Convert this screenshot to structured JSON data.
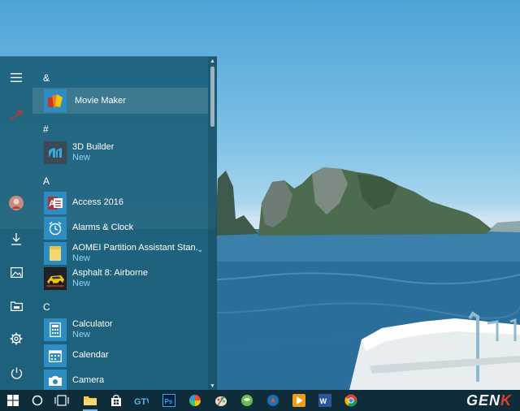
{
  "start_menu": {
    "left_rail": [
      {
        "name": "hamburger-menu-icon",
        "glyph": "≡"
      },
      {
        "name": "user-avatar-icon",
        "glyph": ""
      },
      {
        "name": "downloads-icon",
        "glyph": "⤓"
      },
      {
        "name": "pictures-icon",
        "glyph": ""
      },
      {
        "name": "file-explorer-icon",
        "glyph": ""
      },
      {
        "name": "settings-icon",
        "glyph": "⚙"
      },
      {
        "name": "power-icon",
        "glyph": "⏻"
      }
    ],
    "sections": {
      "ampersand": "&",
      "hash": "#",
      "a": "A",
      "c": "C"
    },
    "apps": {
      "movie_maker": {
        "label": "Movie Maker",
        "icon": "movie-maker-icon"
      },
      "builder_3d": {
        "label": "3D Builder",
        "badge": "New",
        "icon": "3d-builder-icon"
      },
      "access": {
        "label": "Access 2016",
        "icon": "access-icon"
      },
      "alarms": {
        "label": "Alarms & Clock",
        "icon": "alarm-clock-icon"
      },
      "aomei": {
        "label": "AOMEI Partition Assistant Stan...",
        "badge": "New",
        "icon": "folder-icon"
      },
      "asphalt": {
        "label": "Asphalt 8: Airborne",
        "badge": "New",
        "icon": "asphalt-icon"
      },
      "calculator": {
        "label": "Calculator",
        "badge": "New",
        "icon": "calculator-icon"
      },
      "calendar": {
        "label": "Calendar",
        "icon": "calendar-icon"
      },
      "camera": {
        "label": "Camera",
        "icon": "camera-icon"
      }
    },
    "tile_color": "#2d8dc2"
  },
  "taskbar": {
    "watermark_part1": "GEN",
    "watermark_part2": "K"
  }
}
